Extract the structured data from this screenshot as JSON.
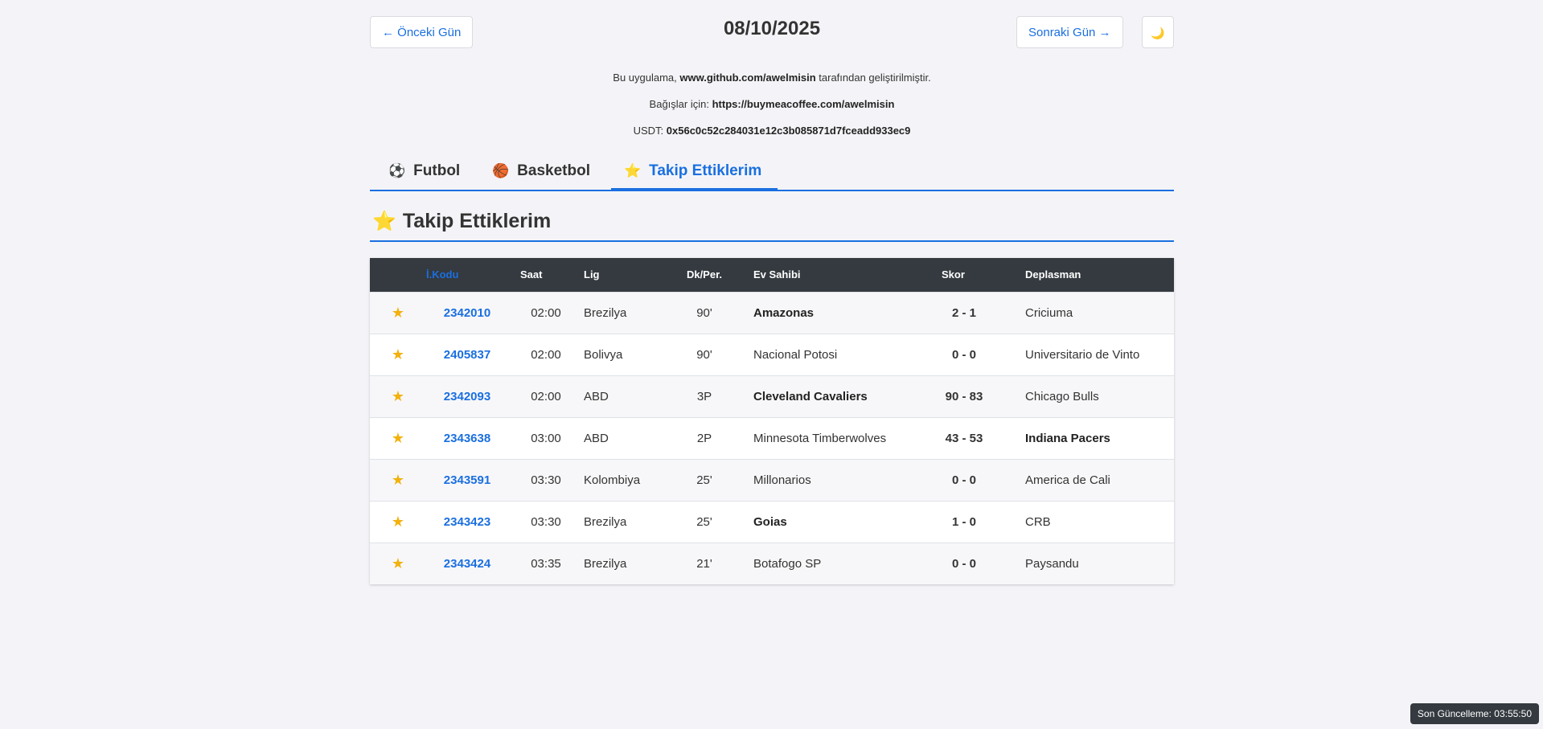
{
  "nav": {
    "prev_label": "← Önceki Gün",
    "next_label": "Sonraki Gün →",
    "date": "08/10/2025",
    "theme_icon": "🌙"
  },
  "info": {
    "line1_prefix": "Bu uygulama, ",
    "line1_link": "www.github.com/awelmisin",
    "line1_suffix": " tarafından geliştirilmiştir.",
    "line2_prefix": "Bağışlar için: ",
    "line2_link": "https://buymeacoffee.com/awelmisin",
    "line3_prefix": "USDT: ",
    "line3_value": "0x56c0c52c284031e12c3b085871d7fceadd933ec9"
  },
  "tabs": [
    {
      "icon": "⚽",
      "label": "Futbol"
    },
    {
      "icon": "🏀",
      "label": "Basketbol"
    },
    {
      "icon": "⭐",
      "label": "Takip Ettiklerim"
    }
  ],
  "section": {
    "icon": "⭐",
    "title": "Takip Ettiklerim"
  },
  "table": {
    "headers": [
      "",
      "İ.Kodu",
      "Saat",
      "Lig",
      "Dk/Per.",
      "Ev Sahibi",
      "Skor",
      "Deplasman"
    ],
    "rows": [
      {
        "code": "2342010",
        "saat": "02:00",
        "lig": "Brezilya",
        "dk": "90'",
        "home": "Amazonas",
        "skor": "2 - 1",
        "away": "Criciuma"
      },
      {
        "code": "2405837",
        "saat": "02:00",
        "lig": "Bolivya",
        "dk": "90'",
        "home": "Nacional Potosi",
        "skor": "0 - 0",
        "away": "Universitario de Vinto"
      },
      {
        "code": "2342093",
        "saat": "02:00",
        "lig": "ABD",
        "dk": "3P",
        "home": "Cleveland Cavaliers",
        "skor": "90 - 83",
        "away": "Chicago Bulls"
      },
      {
        "code": "2343638",
        "saat": "03:00",
        "lig": "ABD",
        "dk": "2P",
        "home": "Minnesota Timberwolves",
        "skor": "43 - 53",
        "away": "Indiana Pacers"
      },
      {
        "code": "2343591",
        "saat": "03:30",
        "lig": "Kolombiya",
        "dk": "25'",
        "home": "Millonarios",
        "skor": "0 - 0",
        "away": "America de Cali"
      },
      {
        "code": "2343423",
        "saat": "03:30",
        "lig": "Brezilya",
        "dk": "25'",
        "home": "Goias",
        "skor": "1 - 0",
        "away": "CRB"
      },
      {
        "code": "2343424",
        "saat": "03:35",
        "lig": "Brezilya",
        "dk": "21'",
        "home": "Botafogo SP",
        "skor": "0 - 0",
        "away": "Paysandu"
      }
    ]
  },
  "footer": {
    "updated": "Son Güncelleme: 03:55:50"
  }
}
